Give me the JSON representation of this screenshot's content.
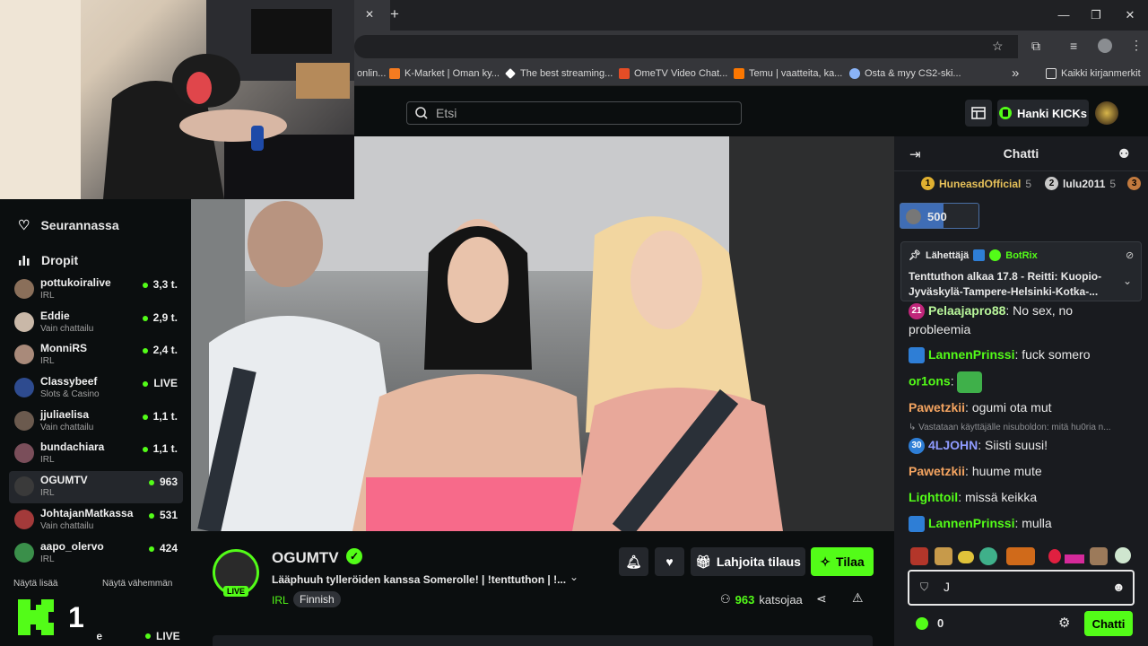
{
  "browser": {
    "tab_close": "✕",
    "tab_new": "+",
    "bookmarks": [
      {
        "label": "onlin...",
        "color": "#9aa0a6"
      },
      {
        "label": "K-Market | Oman ky...",
        "color": "#f47b20"
      },
      {
        "label": "The best streaming...",
        "color": "#ffffff"
      },
      {
        "label": "OmeTV Video Chat...",
        "color": "#e44d26"
      },
      {
        "label": "Temu | vaatteita, ka...",
        "color": "#fb7701"
      },
      {
        "label": "Osta & myy CS2-ski...",
        "color": "#8ab4f8"
      }
    ],
    "more_bookmarks": "»",
    "all_bookmarks": "Kaikki kirjanmerkit"
  },
  "header": {
    "search_placeholder": "Etsi",
    "kicks_label": "Hanki KICKs"
  },
  "sidebar": {
    "following_label": "Seurannassa",
    "drops_label": "Dropit",
    "channels": [
      {
        "name": "pottukoiralive",
        "category": "IRL",
        "viewers": "3,3 t.",
        "avatar": "#8a6f5a"
      },
      {
        "name": "Eddie",
        "category": "Vain chattailu",
        "viewers": "2,9 t.",
        "avatar": "#c9b8a8"
      },
      {
        "name": "MonniRS",
        "category": "IRL",
        "viewers": "2,4 t.",
        "avatar": "#a98a7a"
      },
      {
        "name": "Classybeef",
        "category": "Slots & Casino",
        "viewers": "LIVE",
        "avatar": "#2e4b8f"
      },
      {
        "name": "jjuliaelisa",
        "category": "Vain chattailu",
        "viewers": "1,1 t.",
        "avatar": "#6b5a4e"
      },
      {
        "name": "bundachiara",
        "category": "IRL",
        "viewers": "1,1 t.",
        "avatar": "#7a4e5a"
      },
      {
        "name": "OGUMTV",
        "category": "IRL",
        "viewers": "963",
        "avatar": "#3a3a3a"
      },
      {
        "name": "JohtajanMatkassa",
        "category": "Vain chattailu",
        "viewers": "531",
        "avatar": "#a33a3a"
      },
      {
        "name": "aapo_olervo",
        "category": "IRL",
        "viewers": "424",
        "avatar": "#3a8f4a"
      }
    ],
    "show_more": "Näytä lisää",
    "show_less": "Näytä vähemmän",
    "partial_channel_name": "ne",
    "partial_channel_viewers": "LIVE",
    "overlay_logo_text": "1"
  },
  "stream": {
    "channel_name": "OGUMTV",
    "title": "Lääphuuh tylleröiden kanssa Somerolle! | !tenttuthon | !...",
    "live_badge": "LIVE",
    "category": "IRL",
    "tag": "Finnish",
    "viewer_count": "963",
    "viewers_label": "katsojaa",
    "gift_label": "Lahjoita tilaus",
    "subscribe_label": "Tilaa"
  },
  "chat": {
    "title": "Chatti",
    "leaders": [
      {
        "rank": "1",
        "name": "HuneasdOfficial",
        "count": "5"
      },
      {
        "rank": "2",
        "name": "lulu2011",
        "count": "5"
      },
      {
        "rank": "3",
        "name": "",
        "count": ""
      }
    ],
    "goal_value": "500",
    "pinned": {
      "prefix": "Lähettäjä",
      "author": "BotRix",
      "text": "Tenttuthon alkaa 17.8 - Reitti: Kuopio-Jyväskylä-Tampere-Helsinki-Kotka-..."
    },
    "messages": [
      {
        "user": "Pelaajapro88",
        "color": "#b8f59a",
        "badge": "21",
        "text": "No sex, no probleemia"
      },
      {
        "user": "LannenPrinssi",
        "color": "#53fc18",
        "text": "fuck somero"
      },
      {
        "user": "or1ons",
        "color": "#53fc18",
        "text": ""
      },
      {
        "user": "Pawetzkii",
        "color": "#f4a460",
        "text": "ogumi ota mut"
      },
      {
        "reply": "Vastataan käyttäjälle nisuboldon: mitä hu0ria n..."
      },
      {
        "user": "4LJOHN",
        "color": "#8f9bff",
        "badge": "30",
        "text": "Siisti suusi!"
      },
      {
        "user": "Pawetzkii",
        "color": "#f4a460",
        "text": "huume mute"
      },
      {
        "user": "Lighttoil",
        "color": "#53fc18",
        "text": "missä keikka"
      },
      {
        "user": "LannenPrinssi",
        "color": "#53fc18",
        "text": "mulla"
      }
    ],
    "input_value": "J",
    "points": "0",
    "send_label": "Chatti"
  },
  "colors": {
    "accent": "#53fc18",
    "chat_bg": "#191b1f",
    "page_bg": "#0b0e0f"
  }
}
